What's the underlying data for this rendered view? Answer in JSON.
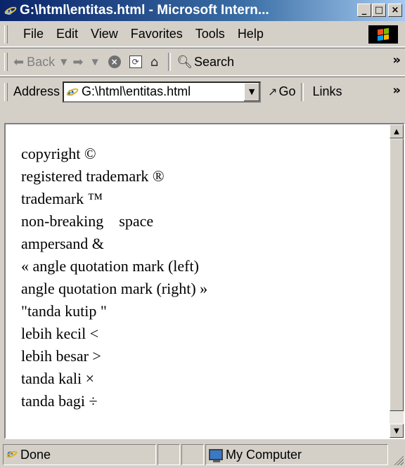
{
  "window": {
    "title": "G:\\html\\entitas.html - Microsoft Intern...",
    "controls": {
      "minimize": "_",
      "maximize": "□",
      "close": "×"
    }
  },
  "menubar": {
    "items": [
      "File",
      "Edit",
      "View",
      "Favorites",
      "Tools",
      "Help"
    ]
  },
  "toolbar": {
    "back_label": "Back",
    "search_label": "Search",
    "overflow": "»",
    "icons": [
      "back-arrow-icon",
      "forward-arrow-icon",
      "stop-icon",
      "refresh-icon",
      "home-icon",
      "search-icon"
    ]
  },
  "addressbar": {
    "label": "Address",
    "url": "G:\\html\\entitas.html",
    "go_label": "Go",
    "links_label": "Links",
    "overflow": "»"
  },
  "content": {
    "lines": [
      "copyright ©",
      "registered trademark ®",
      "trademark ™",
      "non-breaking    space",
      "ampersand &",
      "« angle quotation mark (left)",
      "angle quotation mark (right) »",
      "\"tanda kutip \"",
      "lebih kecil <",
      "lebih besar >",
      "tanda kali ×",
      "tanda bagi ÷"
    ]
  },
  "statusbar": {
    "status_text": "Done",
    "zone_text": "My Computer"
  },
  "colors": {
    "titlebar_start": "#0a246a",
    "titlebar_end": "#a6caf0",
    "chrome": "#d4d0c8",
    "page_background": "#ffffff"
  }
}
